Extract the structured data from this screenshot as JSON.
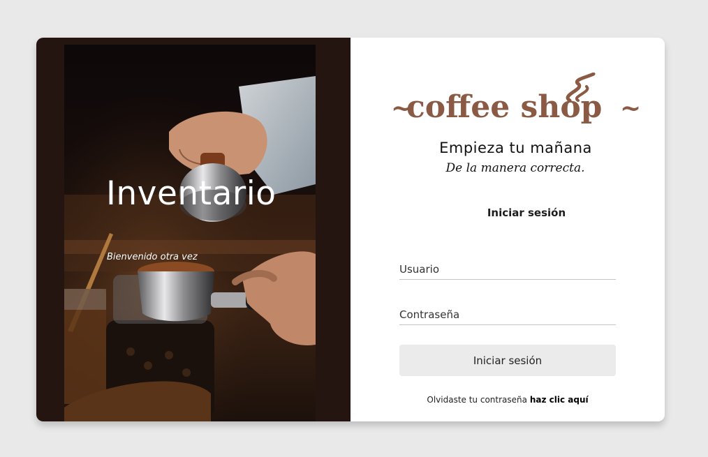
{
  "hero": {
    "title": "Inventario",
    "subtitle": "Bienvenido otra vez"
  },
  "brand": {
    "logo_text": "coffee shop",
    "logo_tilde_left": "~",
    "logo_tilde_right": "~",
    "tagline": "Empieza tu mañana",
    "tagline_script": "De la manera correcta.",
    "color": "#8a5a44"
  },
  "form": {
    "heading": "Iniciar sesión",
    "username_placeholder": "Usuario",
    "password_placeholder": "Contraseña",
    "submit_label": "Iniciar sesión",
    "forgot_text": "Olvidaste tu contraseña",
    "forgot_link": "haz clic aquí"
  },
  "icons": {
    "logo_steam": "coffee-steam-icon"
  }
}
